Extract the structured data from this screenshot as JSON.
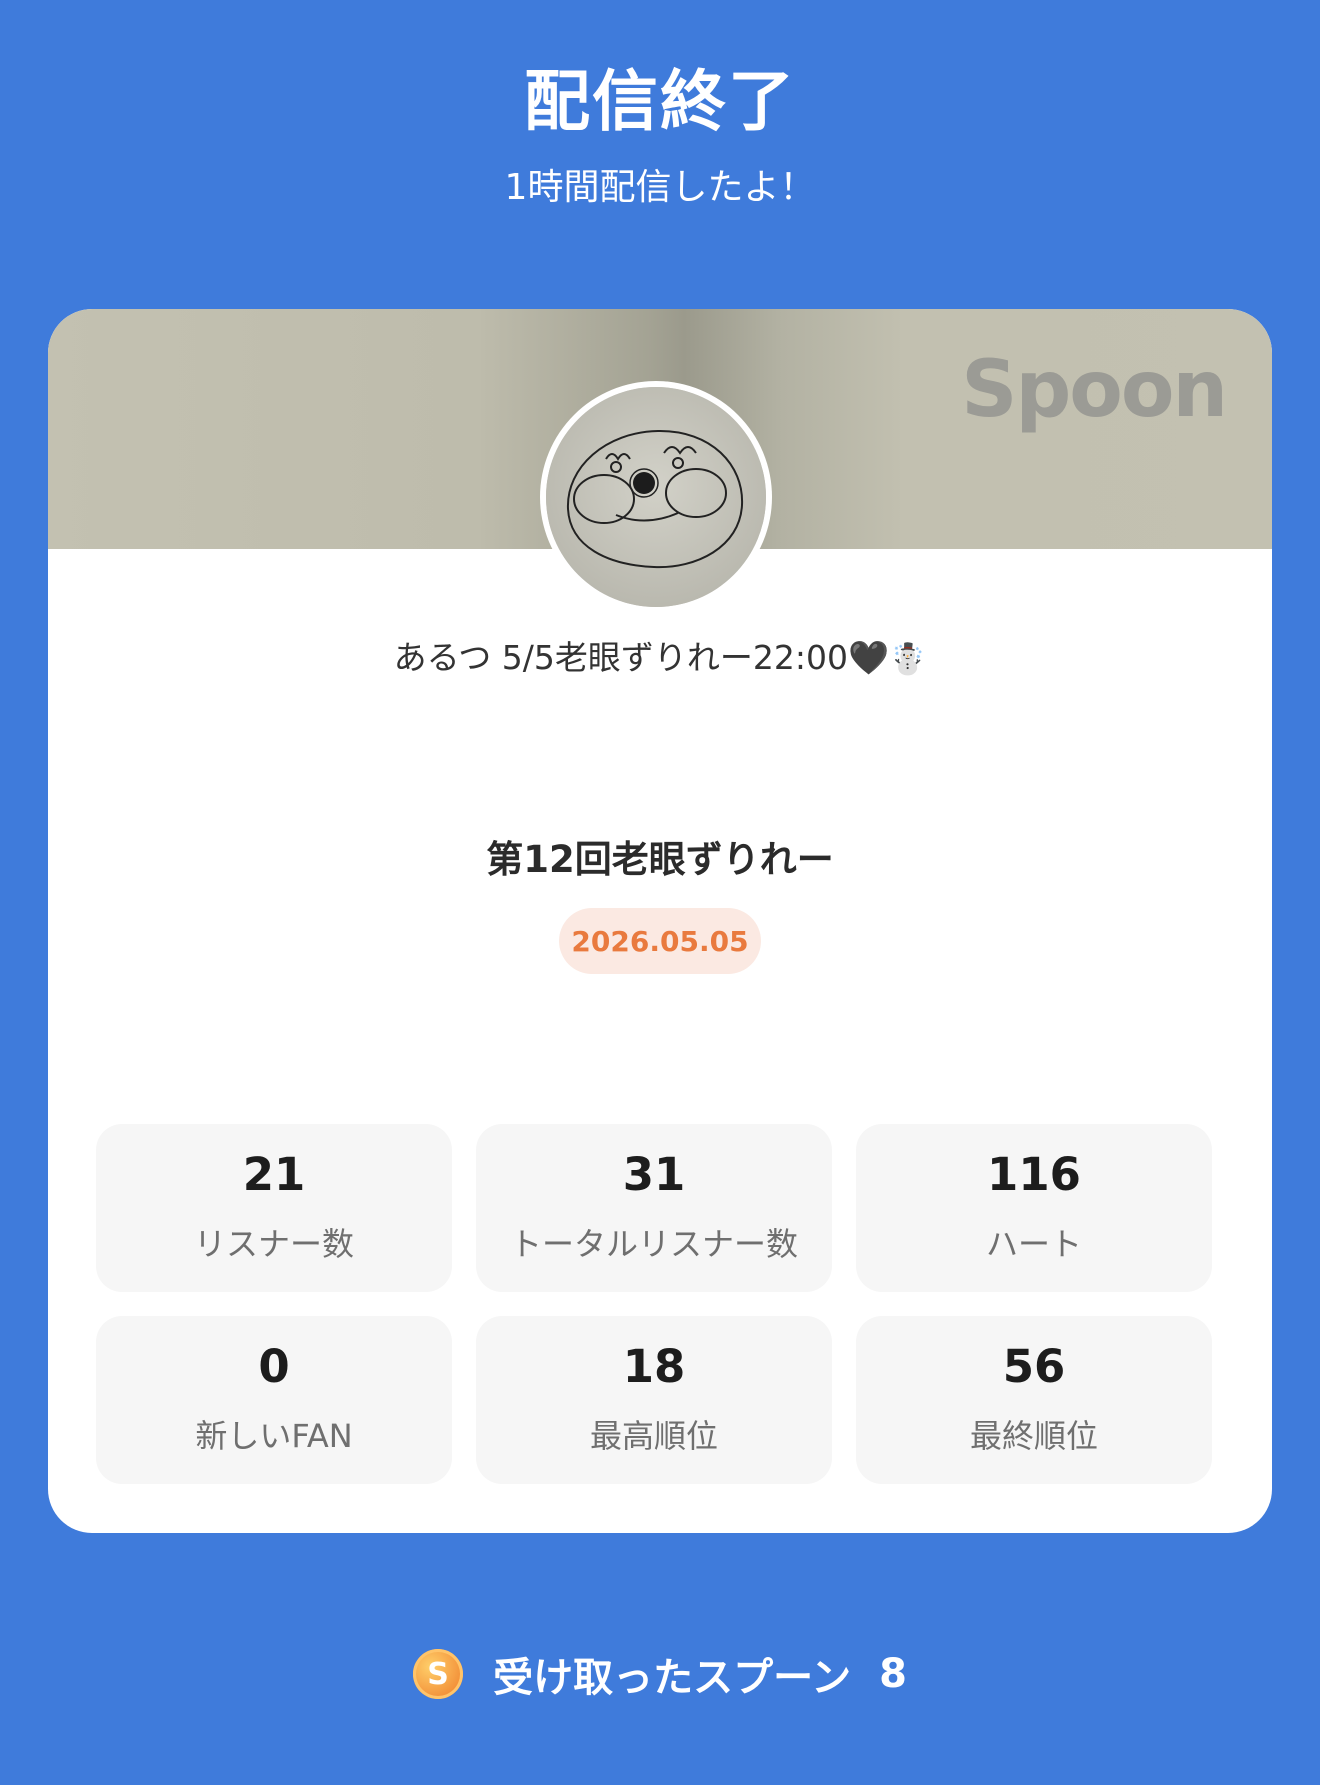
{
  "header": {
    "title": "配信終了",
    "subtitle": "1時間配信したよ！"
  },
  "card": {
    "logo": "Spoon",
    "username": "あるつ 5/5老眼ずりれー22:00",
    "username_emoji_heart": "🖤",
    "username_emoji_snowman": "☃️",
    "broadcast_title": "第12回老眼ずりれー",
    "date": "2026.05.05",
    "stats": [
      {
        "value": "21",
        "label": "リスナー数"
      },
      {
        "value": "31",
        "label": "トータルリスナー数"
      },
      {
        "value": "116",
        "label": "ハート"
      },
      {
        "value": "0",
        "label": "新しいFAN"
      },
      {
        "value": "18",
        "label": "最高順位"
      },
      {
        "value": "56",
        "label": "最終順位"
      }
    ]
  },
  "footer": {
    "icon": "spoon-coin-icon",
    "coin_letter": "S",
    "label": "受け取ったスプーン",
    "count": "8"
  },
  "colors": {
    "background": "#3f7bdb",
    "date_badge_bg": "#fbe9e2",
    "date_text": "#e97a3e",
    "stat_bg": "#f6f6f6"
  }
}
